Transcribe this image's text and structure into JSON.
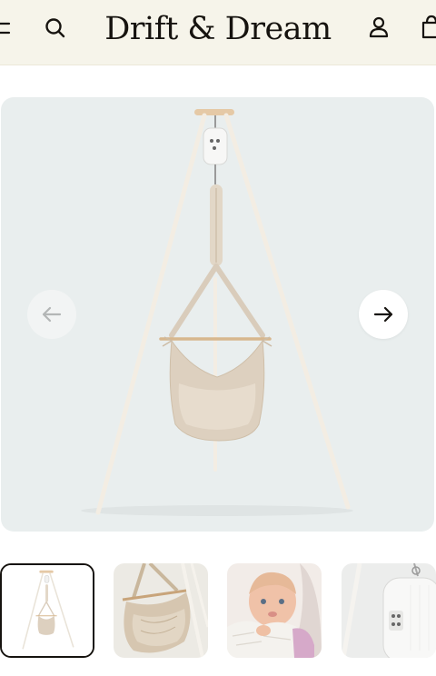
{
  "header": {
    "brand": "Drift & Dream",
    "icons": [
      "menu-icon",
      "search-icon",
      "account-icon",
      "cart-icon"
    ]
  },
  "gallery": {
    "selected_index": 0,
    "thumbnail_count": 4,
    "prev_icon": "arrow-left-icon",
    "next_icon": "arrow-right-icon"
  },
  "colors": {
    "header_bg": "#f6f4ea",
    "hero_bg": "#e9eeee",
    "text": "#16130f",
    "fabric": "#ddd0bf"
  }
}
